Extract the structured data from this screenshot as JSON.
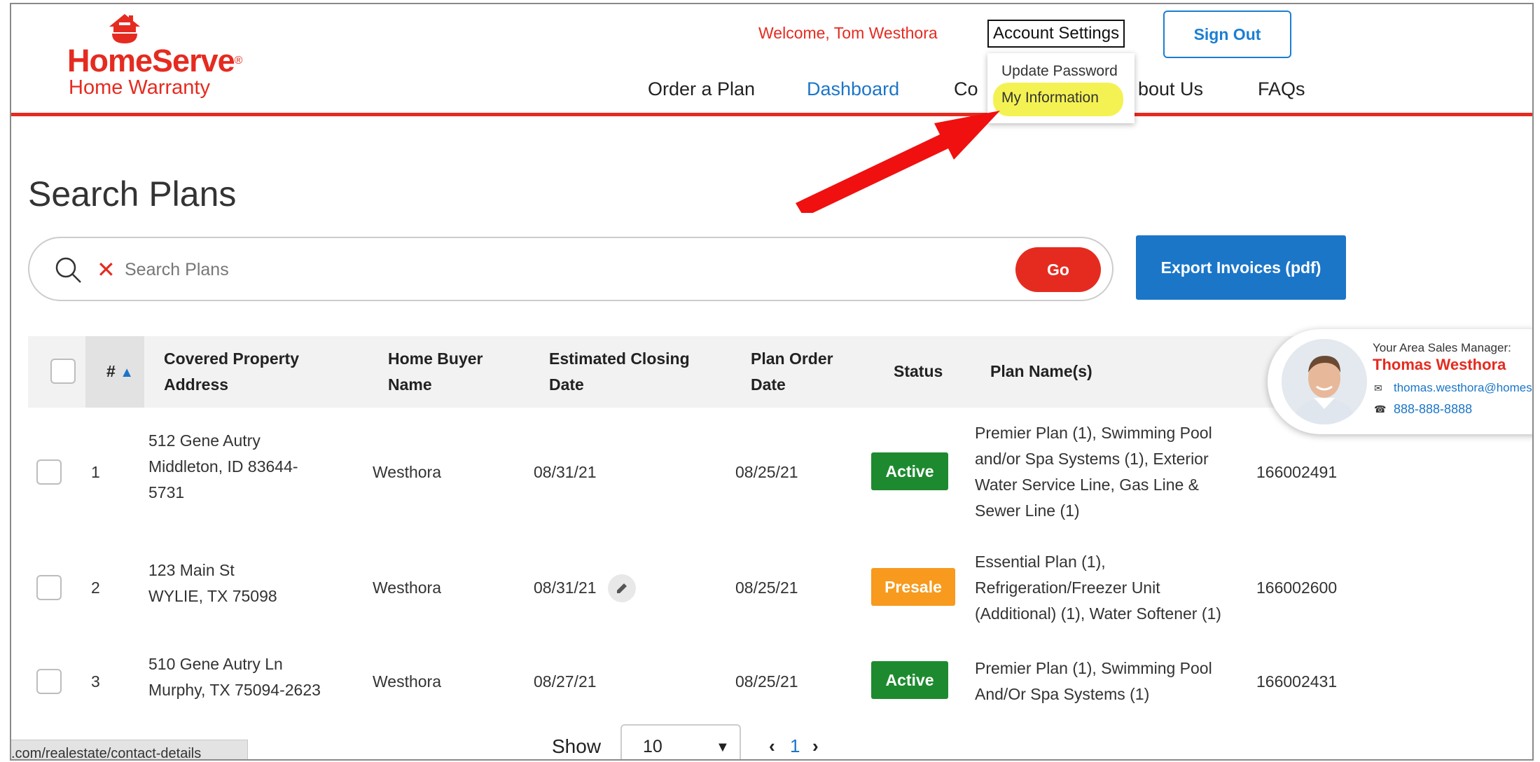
{
  "brand": {
    "name": "HomeServe",
    "tm": "®",
    "subtitle": "Home Warranty",
    "color": "#e52b20"
  },
  "header": {
    "welcome": "Welcome, Tom Westhora",
    "account_settings": "Account Settings",
    "sign_out": "Sign Out",
    "nav": [
      {
        "label": "Order a Plan",
        "active": false
      },
      {
        "label": "Dashboard",
        "active": true
      },
      {
        "label": "Co",
        "active": false
      },
      {
        "label": "bout Us",
        "active": false
      },
      {
        "label": "FAQs",
        "active": false
      }
    ],
    "account_menu": [
      "Update Password",
      "My Information"
    ]
  },
  "page": {
    "title": "Search Plans",
    "search_placeholder": "Search Plans",
    "go": "Go",
    "export": "Export Invoices (pdf)"
  },
  "table": {
    "headers": {
      "num": "#",
      "address": [
        "Covered Property",
        "Address"
      ],
      "buyer": [
        "Home Buyer",
        "Name"
      ],
      "closing": [
        "Estimated Closing",
        "Date"
      ],
      "order": [
        "Plan Order",
        "Date"
      ],
      "status": "Status",
      "plans": "Plan Name(s)"
    },
    "sort_indicator": "▲",
    "rows": [
      {
        "num": "1",
        "address": [
          "512 Gene Autry",
          "Middleton, ID 83644-",
          "5731"
        ],
        "buyer": "Westhora",
        "closing": "08/31/21",
        "order": "08/25/21",
        "status": "Active",
        "plans": [
          "Premier Plan (1), Swimming Pool",
          "and/or Spa Systems (1), Exterior",
          "Water Service Line, Gas Line &",
          "Sewer Line (1)"
        ],
        "plan_id": "166002491"
      },
      {
        "num": "2",
        "address": [
          "123 Main St",
          "WYLIE, TX 75098"
        ],
        "buyer": "Westhora",
        "closing": "08/31/21",
        "order": "08/25/21",
        "status": "Presale",
        "plans": [
          "Essential Plan (1),",
          "Refrigeration/Freezer Unit",
          "(Additional) (1), Water Softener (1)"
        ],
        "plan_id": "166002600"
      },
      {
        "num": "3",
        "address": [
          "510 Gene Autry Ln",
          "Murphy, TX 75094-2623"
        ],
        "buyer": "Westhora",
        "closing": "08/27/21",
        "order": "08/25/21",
        "status": "Active",
        "plans": [
          "Premier Plan (1), Swimming Pool",
          "And/Or Spa Systems (1)"
        ],
        "plan_id": "166002431"
      }
    ]
  },
  "sales_manager": {
    "title": "Your Area Sales Manager:",
    "name": "Thomas Westhora",
    "email": "thomas.westhora@homese",
    "phone": "888-888-8888"
  },
  "footer": {
    "status_url": ".com/realestate/contact-details",
    "show_label": "Show",
    "page_size": "10",
    "current_page": "1",
    "prev": "‹",
    "next": "›"
  },
  "colors": {
    "red": "#e52b20",
    "blue": "#1b76c8",
    "active_green": "#1e8a2f",
    "presale_orange": "#f79a1d",
    "highlight": "#f4f253"
  }
}
